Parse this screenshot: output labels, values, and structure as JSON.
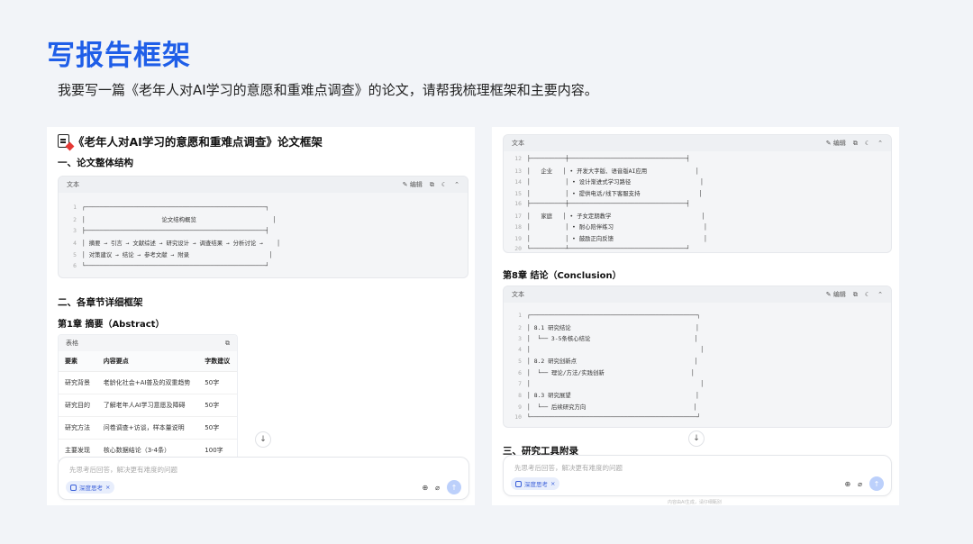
{
  "slide": {
    "title": "写报告框架",
    "prompt": "我要写一篇《老年人对AI学习的意愿和重难点调查》的论文，请帮我梳理框架和主要内容。"
  },
  "left": {
    "doc_title": "《老年人对AI学习的意愿和重难点调查》论文框架",
    "section1": "一、论文整体结构",
    "code1": {
      "label": "文本",
      "edit": "编辑",
      "lines": [
        {
          "n": "1",
          "t": "┌────────────────────────────────────────────────────┐"
        },
        {
          "n": "2",
          "t": "│                      论文结构概览                      │"
        },
        {
          "n": "3",
          "t": "├────────────────────────────────────────────────────┤"
        },
        {
          "n": "4",
          "t": "│ 摘要 → 引言 → 文献综述 → 研究设计 → 调查结果 → 分析讨论 →    │"
        },
        {
          "n": "5",
          "t": "│ 对策建议 → 结论 → 参考文献 → 附录                       │"
        },
        {
          "n": "6",
          "t": "└────────────────────────────────────────────────────┘"
        }
      ]
    },
    "section2": "二、各章节详细框架",
    "chapter1": "第1章 摘要（Abstract）",
    "table": {
      "label": "表格",
      "headers": [
        "要素",
        "内容要点",
        "字数建议"
      ],
      "rows": [
        [
          "研究背景",
          "老龄化社会+AI普及的双重趋势",
          "50字"
        ],
        [
          "研究目的",
          "了解老年人AI学习意愿及障碍",
          "50字"
        ],
        [
          "研究方法",
          "问卷调查+访谈，样本量说明",
          "50字"
        ],
        [
          "主要发现",
          "核心数据结论（3-4条）",
          "100字"
        ]
      ]
    },
    "input_placeholder": "先思考后回答，解决更有难度的问题",
    "chip": "深度思考"
  },
  "right": {
    "code_top": {
      "label": "文本",
      "edit": "编辑",
      "lines": [
        {
          "n": "12",
          "t": "├──────────┼──────────────────────────────────┤"
        },
        {
          "n": "13",
          "t": "│   企业   │ • 开发大字版、语音版AI应用              │"
        },
        {
          "n": "14",
          "t": "│          │ • 设计渐进式学习路径                    │"
        },
        {
          "n": "15",
          "t": "│          │ • 提供电话/线下客服支持                 │"
        },
        {
          "n": "16",
          "t": "├──────────┼──────────────────────────────────┤"
        },
        {
          "n": "17",
          "t": "│   家庭   │ • 子女定期教学                          │"
        },
        {
          "n": "18",
          "t": "│          │ • 耐心陪伴练习                          │"
        },
        {
          "n": "19",
          "t": "│          │ • 鼓励正向反馈                          │"
        },
        {
          "n": "20",
          "t": "└──────────┴──────────────────────────────────┘"
        }
      ]
    },
    "chapter8": "第8章 结论（Conclusion）",
    "code_bottom": {
      "label": "文本",
      "edit": "编辑",
      "lines": [
        {
          "n": "1",
          "t": "┌────────────────────────────────────────────────┐"
        },
        {
          "n": "2",
          "t": "│ 8.1 研究结论                                    │"
        },
        {
          "n": "3",
          "t": "│  └── 3-5条核心结论                              │"
        },
        {
          "n": "4",
          "t": "│                                                 │"
        },
        {
          "n": "5",
          "t": "│ 8.2 研究创新点                                  │"
        },
        {
          "n": "6",
          "t": "│  └── 理论/方法/实践创新                         │"
        },
        {
          "n": "7",
          "t": "│                                                 │"
        },
        {
          "n": "8",
          "t": "│ 8.3 研究展望                                    │"
        },
        {
          "n": "9",
          "t": "│  └── 后续研究方向                               │"
        },
        {
          "n": "10",
          "t": "└────────────────────────────────────────────────┘"
        }
      ]
    },
    "section3": "三、研究工具附录",
    "input_placeholder": "先思考后回答，解决更有难度的问题",
    "chip": "深度思考",
    "footer": "内容由AI生成，请仔细甄别"
  },
  "colors": {
    "accent": "#1f5ee8",
    "chip_bg": "#e8eefc",
    "send": "#bcd0fb"
  },
  "icons": [
    "document-icon",
    "edit-icon",
    "copy-icon",
    "moon-icon",
    "chevron-up-icon",
    "arrow-down-icon",
    "globe-icon",
    "paperclip-icon",
    "send-icon"
  ]
}
